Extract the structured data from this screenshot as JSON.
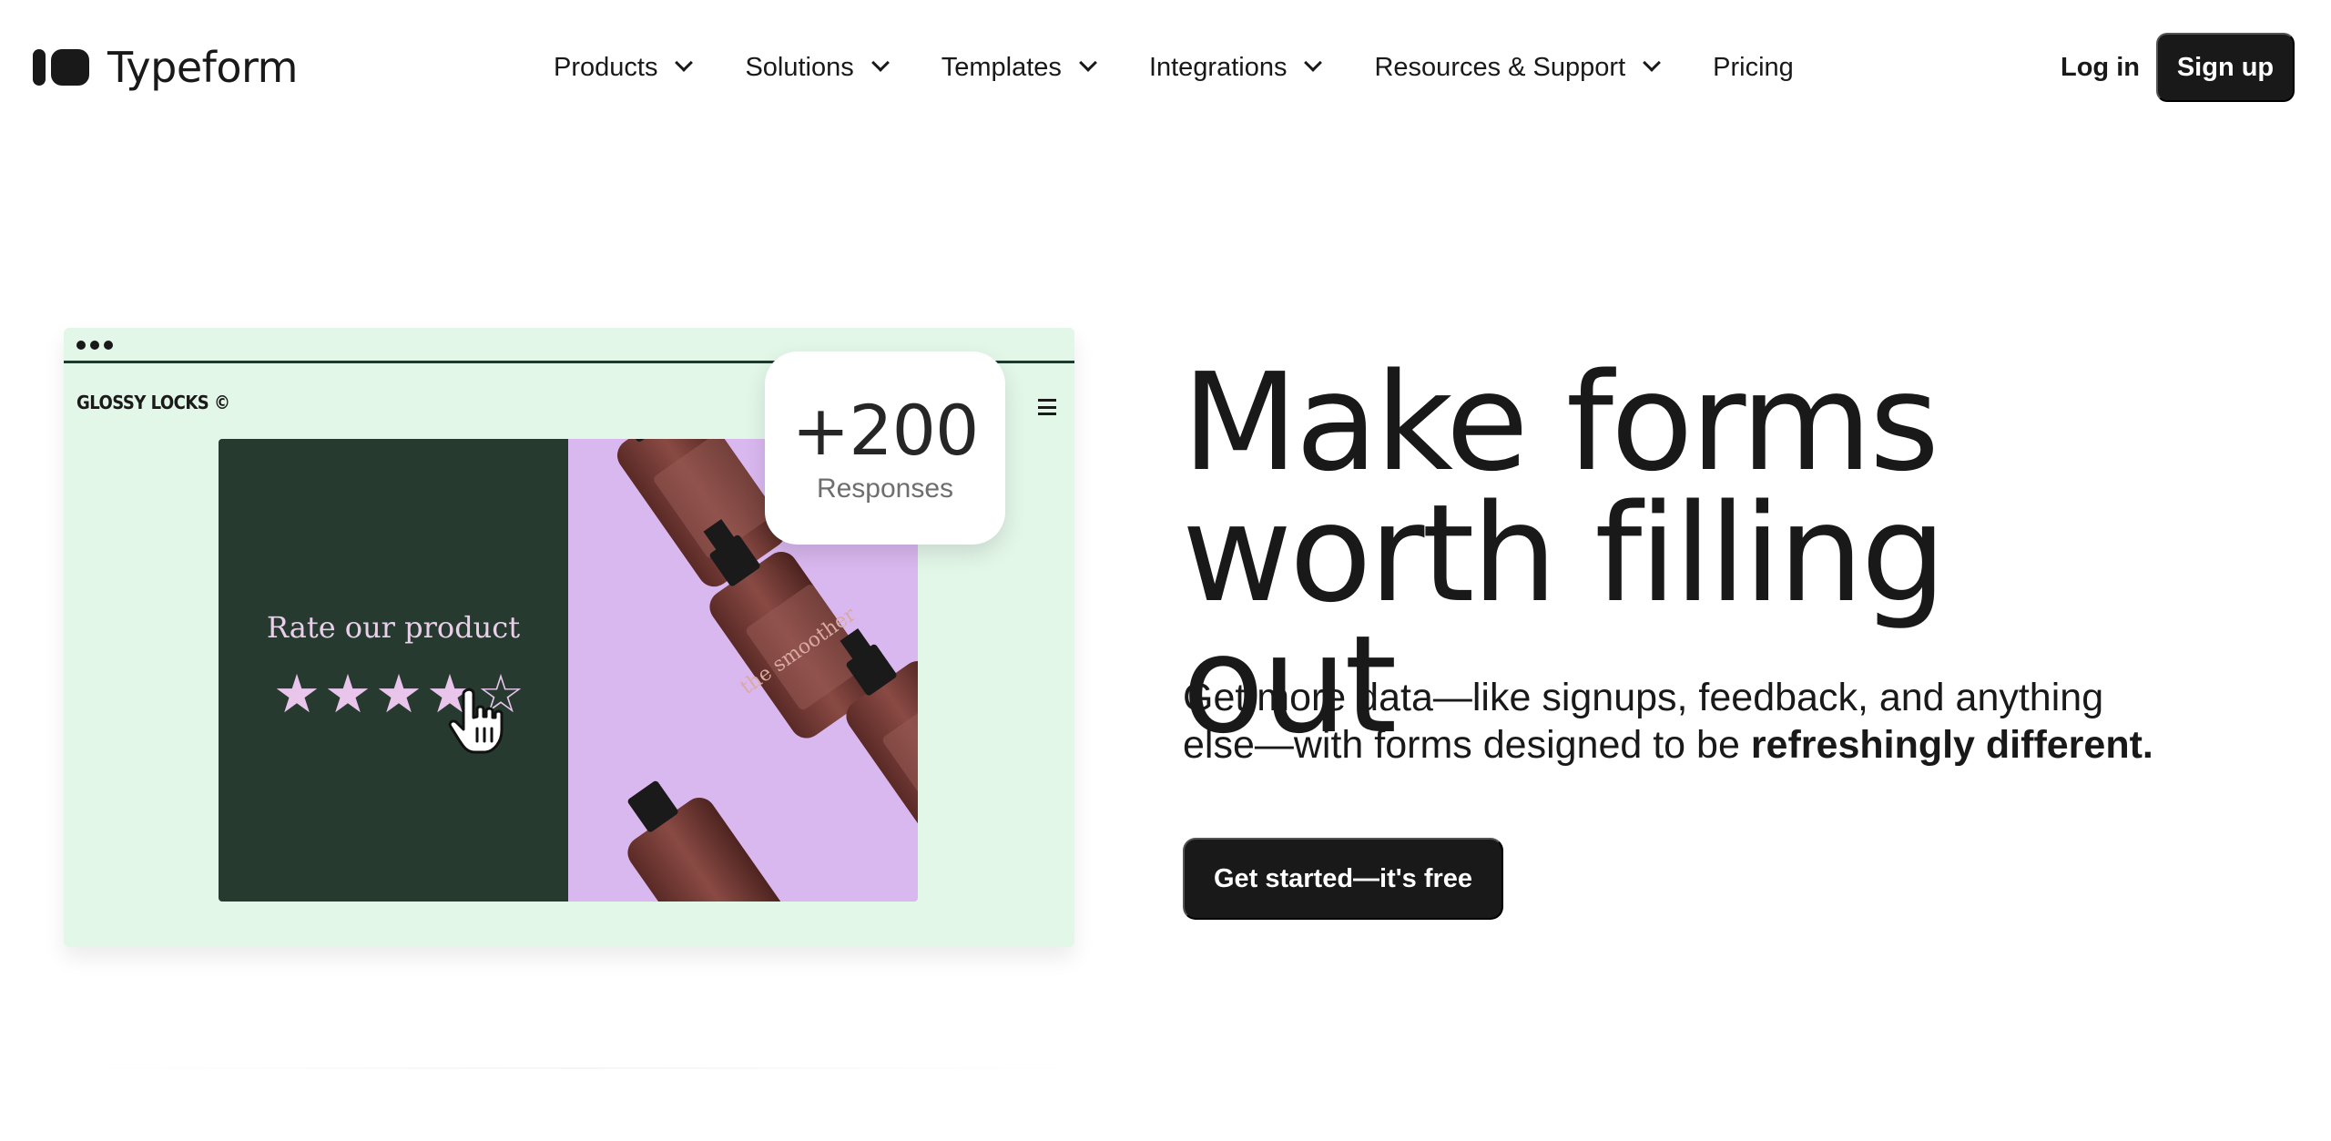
{
  "nav": {
    "logo_text": "Typeform",
    "menu": [
      {
        "label": "Products"
      },
      {
        "label": "Solutions"
      },
      {
        "label": "Templates"
      },
      {
        "label": "Integrations"
      },
      {
        "label": "Resources & Support"
      },
      {
        "label": "Pricing"
      }
    ],
    "login_label": "Log in",
    "signup_label": "Sign up"
  },
  "hero": {
    "headline_line1": "Make forms",
    "headline_line2": "worth filling out",
    "subtext_plain": "Get more data—like signups, feedback, and anything else—with forms designed to be ",
    "subtext_bold": "refreshingly different.",
    "cta_label": "Get started—it's free"
  },
  "media": {
    "brand": "GLOSSY LOCKS ©",
    "card_title": "Rate our product",
    "rating_value": 4,
    "rating_max": 5,
    "bottle_label": "the smoother",
    "badge_number": "+200",
    "badge_label": "Responses"
  },
  "colors": {
    "text": "#191919",
    "media_bg": "#e3f7e9",
    "card_dark": "#263a2f",
    "card_purple": "#d9b8ef",
    "star": "#e9c5ec",
    "button": "#191919"
  }
}
